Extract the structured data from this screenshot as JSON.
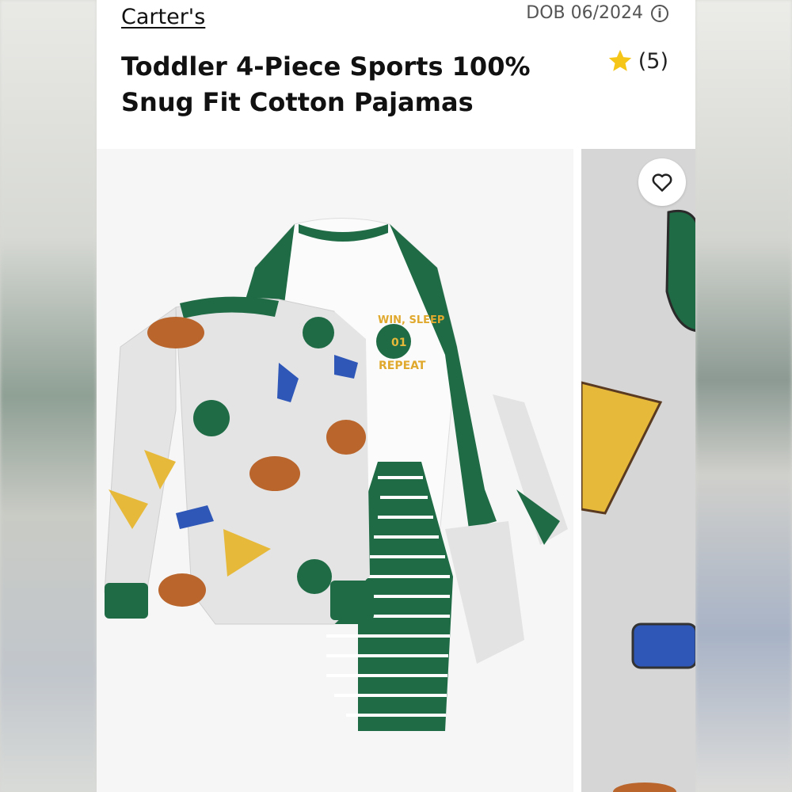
{
  "listing": {
    "brand": "Carter's",
    "dob_label": "DOB 06/2024",
    "title": "Toddler 4-Piece Sports 100% Snug Fit Cotton Pajamas",
    "rating_count": "(5)"
  },
  "icons": {
    "info": "info-icon",
    "star": "star-icon",
    "favorite": "heart-icon"
  },
  "images": {
    "main": "product-photo",
    "secondary": "detail-photo"
  },
  "colors": {
    "accent_green": "#1e6b45",
    "star_yellow": "#f5c518",
    "pennant_yellow": "#e7b93a",
    "football_brown": "#b9652c",
    "cleat_blue": "#2e57b8"
  }
}
